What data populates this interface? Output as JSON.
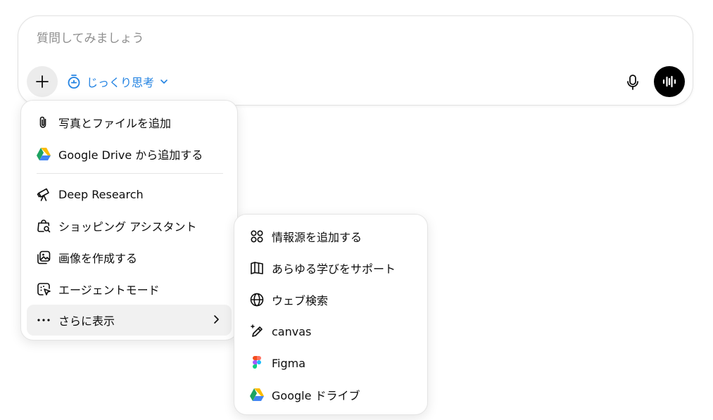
{
  "composer": {
    "placeholder": "質問してみましょう",
    "think_label": "じっくり思考"
  },
  "menu": {
    "items": [
      {
        "label": "写真とファイルを追加",
        "icon": "paperclip-icon"
      },
      {
        "label": "Google Drive から追加する",
        "icon": "google-drive-icon"
      },
      {
        "label": "Deep Research",
        "icon": "telescope-icon"
      },
      {
        "label": "ショッピング アシスタント",
        "icon": "shopping-bag-search-icon"
      },
      {
        "label": "画像を作成する",
        "icon": "image-create-icon"
      },
      {
        "label": "エージェントモード",
        "icon": "agent-cursor-icon"
      },
      {
        "label": "さらに表示",
        "icon": "more-dots-icon"
      }
    ]
  },
  "submenu": {
    "items": [
      {
        "label": "情報源を追加する",
        "icon": "sources-icon"
      },
      {
        "label": "あらゆる学びをサポート",
        "icon": "book-icon"
      },
      {
        "label": "ウェブ検索",
        "icon": "globe-icon"
      },
      {
        "label": "canvas",
        "icon": "canvas-pen-icon"
      },
      {
        "label": "Figma",
        "icon": "figma-icon"
      },
      {
        "label": "Google ドライブ",
        "icon": "google-drive-icon"
      }
    ]
  },
  "colors": {
    "accent": "#2383e2",
    "menu_active_bg": "#f1f1f1",
    "voice_button_bg": "#000000"
  }
}
